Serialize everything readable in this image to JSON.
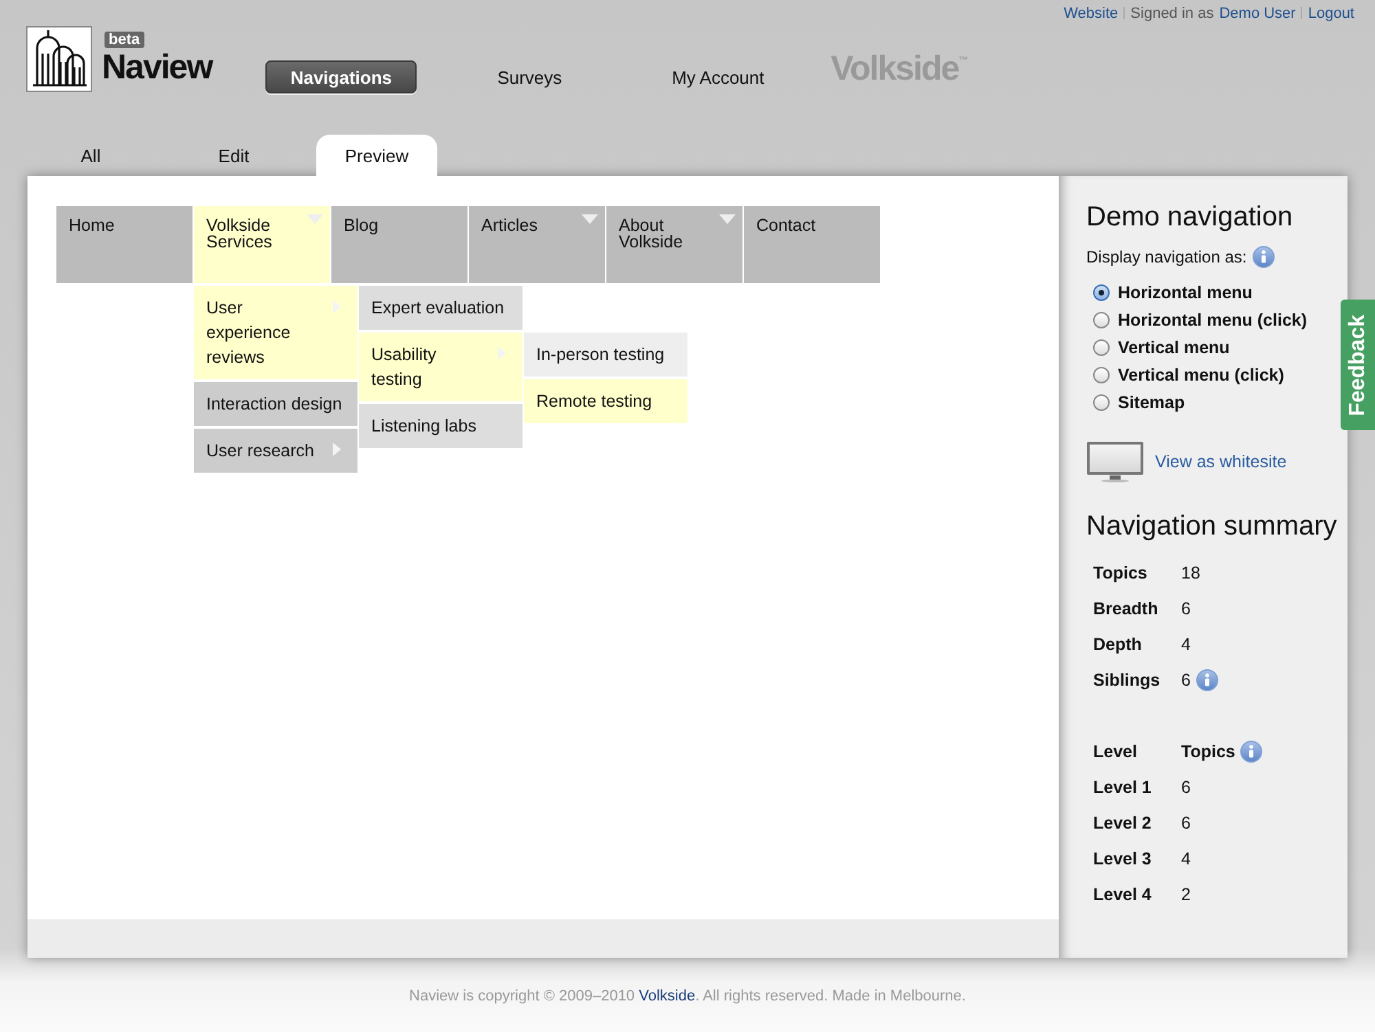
{
  "top_links": [
    {
      "label": "Website",
      "kind": "link"
    },
    {
      "label": "Signed in as",
      "kind": "text"
    },
    {
      "label": "Demo User",
      "kind": "link"
    },
    {
      "label": "Logout",
      "kind": "link"
    }
  ],
  "logo": {
    "badge": "beta",
    "name": "Naview"
  },
  "main_nav": [
    {
      "label": "Navigations",
      "selected": true
    },
    {
      "label": "Surveys",
      "selected": false
    },
    {
      "label": "My Account",
      "selected": false
    }
  ],
  "brand": {
    "name": "Volkside",
    "mark": "™"
  },
  "tabs": [
    {
      "label": "All",
      "selected": false
    },
    {
      "label": "Edit",
      "selected": false
    },
    {
      "label": "Preview",
      "selected": true
    }
  ],
  "menu": {
    "items": [
      {
        "label": "Home",
        "highlighted": false,
        "has_submenu": false
      },
      {
        "label": "Volkside Services",
        "highlighted": true,
        "has_submenu": true,
        "children": [
          {
            "label": "User experience reviews",
            "highlighted": true,
            "has_submenu": true,
            "children": [
              {
                "label": "Expert evaluation",
                "highlighted": false,
                "has_submenu": false
              },
              {
                "label": "Usability testing",
                "highlighted": true,
                "has_submenu": true,
                "children": [
                  {
                    "label": "In-person testing",
                    "highlighted": false,
                    "has_submenu": false
                  },
                  {
                    "label": "Remote testing",
                    "highlighted": true,
                    "has_submenu": false
                  }
                ]
              },
              {
                "label": "Listening labs",
                "highlighted": false,
                "has_submenu": false
              }
            ]
          },
          {
            "label": "Interaction design",
            "highlighted": false,
            "has_submenu": false
          },
          {
            "label": "User research",
            "highlighted": false,
            "has_submenu": true
          }
        ]
      },
      {
        "label": "Blog",
        "highlighted": false,
        "has_submenu": false
      },
      {
        "label": "Articles",
        "highlighted": false,
        "has_submenu": true
      },
      {
        "label": "About Volkside",
        "highlighted": false,
        "has_submenu": true
      },
      {
        "label": "Contact",
        "highlighted": false,
        "has_submenu": false
      }
    ]
  },
  "sidebar": {
    "title": "Demo navigation",
    "display_label": {
      "label": "Display navigation as:",
      "info": true
    },
    "display_options": [
      {
        "label": "Horizontal menu",
        "selected": true
      },
      {
        "label": "Horizontal menu (click)",
        "selected": false
      },
      {
        "label": "Vertical menu",
        "selected": false
      },
      {
        "label": "Vertical menu (click)",
        "selected": false
      },
      {
        "label": "Sitemap",
        "selected": false
      }
    ],
    "whitesite_link": "View as whitesite",
    "summary_title": "Navigation summary",
    "summary": [
      {
        "label": "Topics",
        "value": "18",
        "info": false
      },
      {
        "label": "Breadth",
        "value": "6",
        "info": false
      },
      {
        "label": "Depth",
        "value": "4",
        "info": false
      },
      {
        "label": "Siblings",
        "value": "6",
        "info": true
      }
    ],
    "levels": {
      "columns": [
        {
          "label": "Level",
          "info": false
        },
        {
          "label": "Topics",
          "info": true
        }
      ],
      "rows": [
        {
          "level": "Level 1",
          "topics": "6"
        },
        {
          "level": "Level 2",
          "topics": "6"
        },
        {
          "level": "Level 3",
          "topics": "4"
        },
        {
          "level": "Level 4",
          "topics": "2"
        }
      ]
    }
  },
  "feedback": "Feedback",
  "footer": {
    "text_before": "Naview is copyright © 2009–2010 ",
    "link": "Volkside",
    "text_after": ". All rights reserved. Made in Melbourne."
  }
}
